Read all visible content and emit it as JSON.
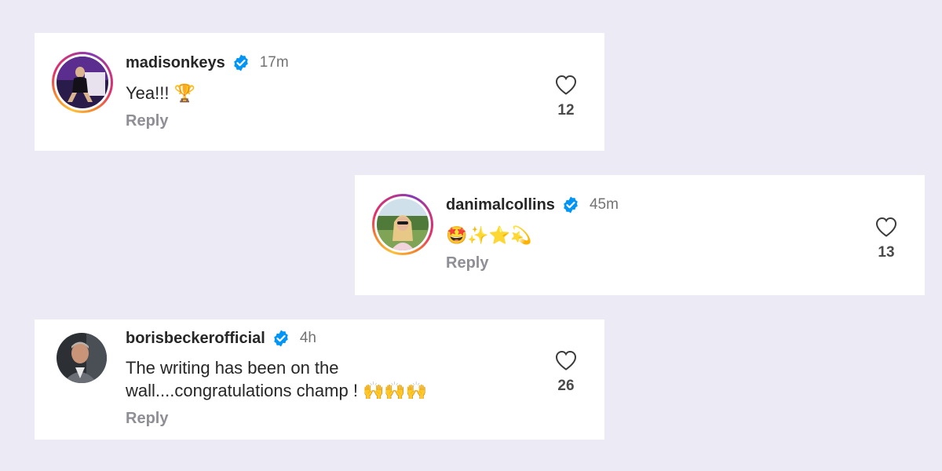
{
  "comments": [
    {
      "username": "madisonkeys",
      "verified": true,
      "time": "17m",
      "text": "Yea!!! 🏆",
      "reply_label": "Reply",
      "likes": "12",
      "avatar_icon": "madisonkeys-avatar",
      "story_ring": true
    },
    {
      "username": "danimalcollins",
      "verified": true,
      "time": "45m",
      "text": "🤩✨⭐💫",
      "reply_label": "Reply",
      "likes": "13",
      "avatar_icon": "danimalcollins-avatar",
      "story_ring": true
    },
    {
      "username": "borisbeckerofficial",
      "verified": true,
      "time": "4h",
      "text": "The writing has been on the wall....congratulations champ ! 🙌🙌🙌",
      "reply_label": "Reply",
      "likes": "26",
      "avatar_icon": "borisbeckerofficial-avatar",
      "story_ring": false
    }
  ],
  "colors": {
    "background": "#ecebf5",
    "card": "#ffffff",
    "verified_badge": "#0095f6",
    "username": "#262626",
    "meta_text": "#737373",
    "reply_text": "#8e8e96"
  },
  "icons": {
    "verified": "verified-badge-icon",
    "like": "heart-outline-icon"
  }
}
